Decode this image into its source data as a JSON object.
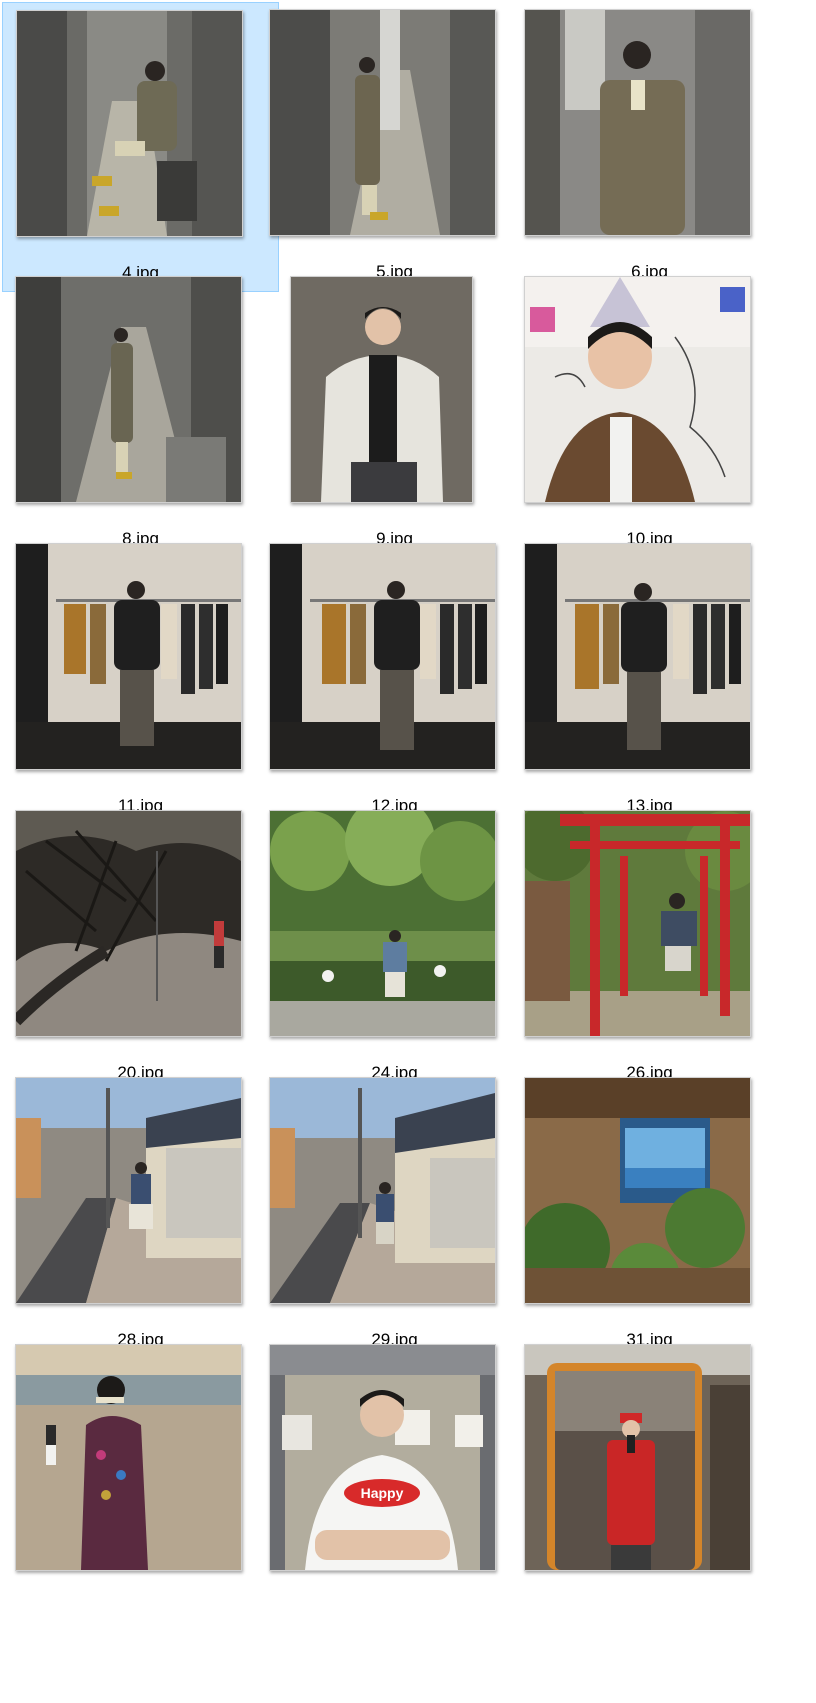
{
  "files": [
    {
      "name": "4.jpg",
      "selected": true
    },
    {
      "name": "5.jpg",
      "selected": false
    },
    {
      "name": "6.jpg",
      "selected": false
    },
    {
      "name": "8.jpg",
      "selected": false
    },
    {
      "name": "9.jpg",
      "selected": false
    },
    {
      "name": "10.jpg",
      "selected": false
    },
    {
      "name": "11.jpg",
      "selected": false
    },
    {
      "name": "12.jpg",
      "selected": false
    },
    {
      "name": "13.jpg",
      "selected": false
    },
    {
      "name": "20.jpg",
      "selected": false
    },
    {
      "name": "24.jpg",
      "selected": false
    },
    {
      "name": "26.jpg",
      "selected": false
    },
    {
      "name": "28.jpg",
      "selected": false
    },
    {
      "name": "29.jpg",
      "selected": false
    },
    {
      "name": "31.jpg",
      "selected": false
    },
    {
      "name": "",
      "selected": false
    },
    {
      "name": "",
      "selected": false
    },
    {
      "name": "",
      "selected": false
    }
  ],
  "image_texts": {
    "happy_shirt": "Happy"
  }
}
